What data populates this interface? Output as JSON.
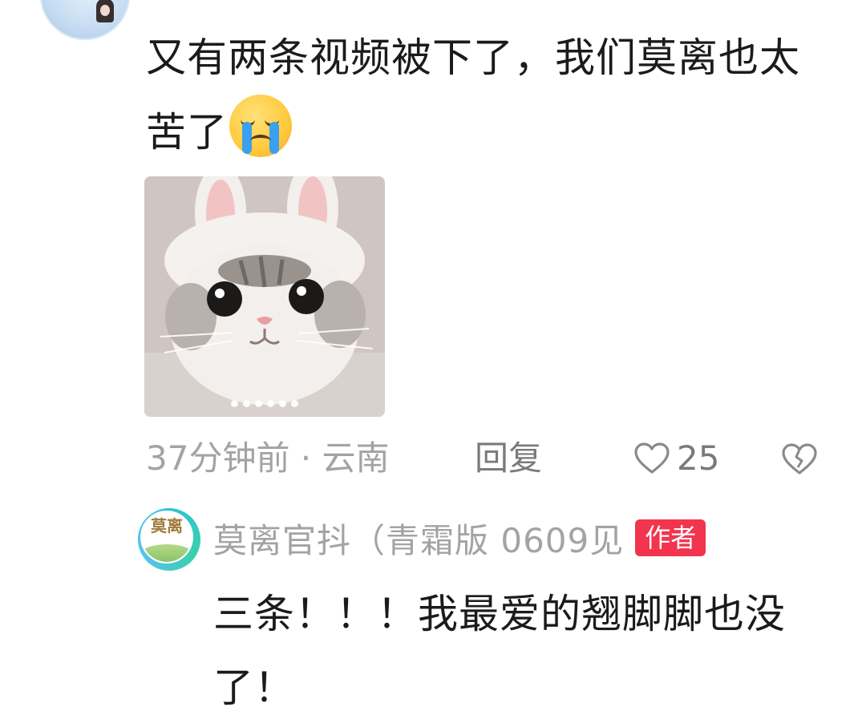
{
  "comment": {
    "text": "又有两条视频被下了，我们莫离也太苦了",
    "emoji": "crying-face-emoji",
    "image": {
      "subject": "cat-in-bunny-hat",
      "page_count": 6
    },
    "time_location": "37分钟前 · 云南",
    "reply_label": "回复",
    "like_count": "25",
    "icons": {
      "like": "heart-outline-icon",
      "dislike": "broken-heart-icon"
    }
  },
  "reply": {
    "author": "莫离官抖（青霜版 0609见",
    "badge": "作者",
    "avatar_glyph": "莫离",
    "text": "三条！！！我最爱的翘脚脚也没了！"
  },
  "colors": {
    "text_primary": "#1b1b1b",
    "text_secondary": "#a3a3a3",
    "badge_bg": "#f2344f"
  }
}
